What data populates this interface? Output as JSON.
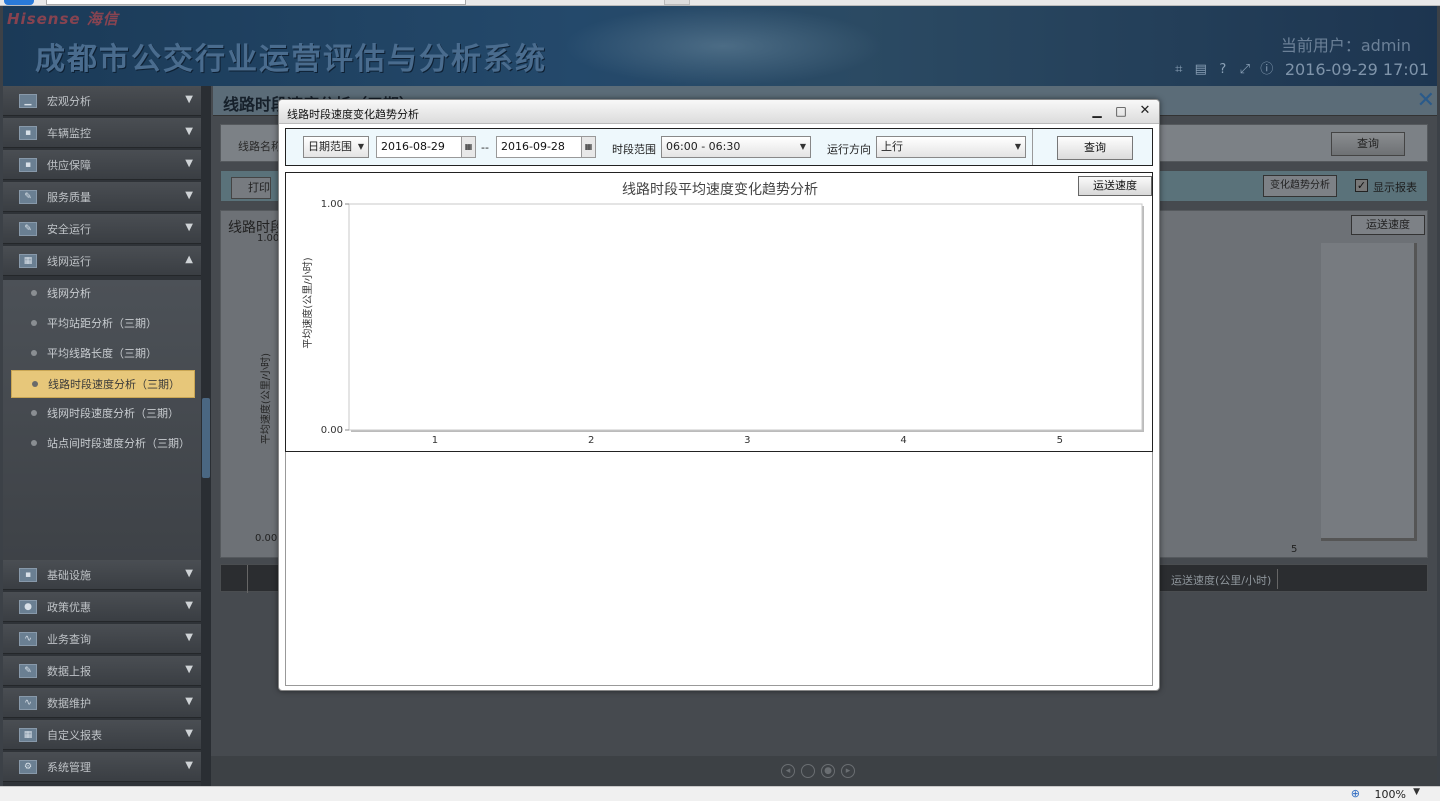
{
  "header": {
    "brand": "Hisense 海信",
    "system_name": "成都市公交行业运营评估与分析系统",
    "current_user": "当前用户：admin",
    "datetime": "2016-09-29 17:01"
  },
  "sidebar": {
    "top_items": [
      {
        "label": "宏观分析",
        "icon": "chart-icon"
      },
      {
        "label": "车辆监控",
        "icon": "bus-icon"
      },
      {
        "label": "供应保障",
        "icon": "supply-icon"
      },
      {
        "label": "服务质量",
        "icon": "pencil-icon"
      },
      {
        "label": "安全运行",
        "icon": "shield-icon"
      },
      {
        "label": "线网运行",
        "icon": "network-icon"
      }
    ],
    "sub_items": [
      {
        "label": "线网分析"
      },
      {
        "label": "平均站距分析（三期）"
      },
      {
        "label": "平均线路长度（三期）"
      },
      {
        "label": "线路时段速度分析（三期）"
      },
      {
        "label": "线网时段速度分析（三期）"
      },
      {
        "label": "站点间时段速度分析（三期）"
      }
    ],
    "bottom_items": [
      {
        "label": "基础设施"
      },
      {
        "label": "政策优惠"
      },
      {
        "label": "业务查询"
      },
      {
        "label": "数据上报"
      },
      {
        "label": "数据维护"
      },
      {
        "label": "自定义报表"
      },
      {
        "label": "系统管理"
      }
    ]
  },
  "content": {
    "title": "线路时段速度分析（三期）",
    "query_label": "线路名称",
    "query_button": "查询",
    "print_button": "打印",
    "trend_button": "变化趋势分析",
    "show_report_label": "显示报表",
    "chart_title": "线路时段",
    "chart_y_max": "1.00",
    "chart_y_min": "0.00",
    "chart_y_label": "平均速度(公里/小时)",
    "chart_button": "运送速度",
    "chart_x_last": "5",
    "grid_col": "运送速度(公里/小时)"
  },
  "dialog": {
    "title": "线路时段速度变化趋势分析",
    "date_mode": "日期范围",
    "start_date": "2016-08-29",
    "date_sep": "--",
    "end_date": "2016-09-28",
    "time_label": "时段范围",
    "time_value": "06:00 - 06:30",
    "direction_label": "运行方向",
    "direction_value": "上行",
    "query_button": "查询",
    "chart_button": "运送速度"
  },
  "chart_data": {
    "type": "line",
    "title": "线路时段平均速度变化趋势分析",
    "ylabel": "平均速度(公里/小时)",
    "xlabel": "",
    "x": [
      1,
      2,
      3,
      4,
      5
    ],
    "series": [],
    "ylim": [
      0,
      1
    ],
    "yticks": [
      "0.00",
      "1.00"
    ],
    "grid": false
  },
  "statusbar": {
    "zoom": "100%"
  }
}
